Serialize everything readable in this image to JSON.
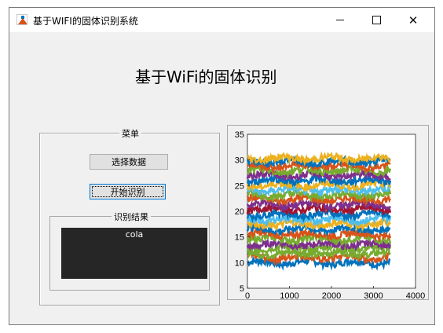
{
  "window": {
    "title": "基于WIFI的固体识别系统"
  },
  "heading": "基于WiFi的固体识别",
  "menu": {
    "title": "菜单",
    "select_button": "选择数据",
    "start_button": "开始识别"
  },
  "result": {
    "title": "识别结果",
    "value": "cola"
  },
  "chart_data": {
    "type": "line",
    "xlim": [
      0,
      4000
    ],
    "ylim": [
      5,
      35
    ],
    "xticks": [
      "0",
      "1000",
      "2000",
      "3000",
      "4000"
    ],
    "yticks": [
      "5",
      "10",
      "15",
      "20",
      "25",
      "30",
      "35"
    ],
    "x_range": [
      0,
      3400
    ],
    "series_levels": [
      10,
      11,
      11.8,
      12.8,
      13.5,
      14.6,
      15.5,
      16.5,
      17.5,
      18.4,
      19.4,
      20.4,
      21.3,
      22.3,
      23.2,
      24.1,
      25.1,
      26.0,
      27.0,
      27.9,
      28.8,
      29.7,
      30.3
    ],
    "series_colors": [
      "#0072bd",
      "#d95319",
      "#77ac30",
      "#77ac30",
      "#7e2f8e",
      "#77ac30",
      "#d95319",
      "#0072bd",
      "#edb120",
      "#4dbeee",
      "#0072bd",
      "#a2142f",
      "#7e2f8e",
      "#d95319",
      "#77ac30",
      "#4dbeee",
      "#edb120",
      "#0072bd",
      "#7e2f8e",
      "#77ac30",
      "#d95319",
      "#0072bd",
      "#edb120"
    ],
    "grid": false
  }
}
